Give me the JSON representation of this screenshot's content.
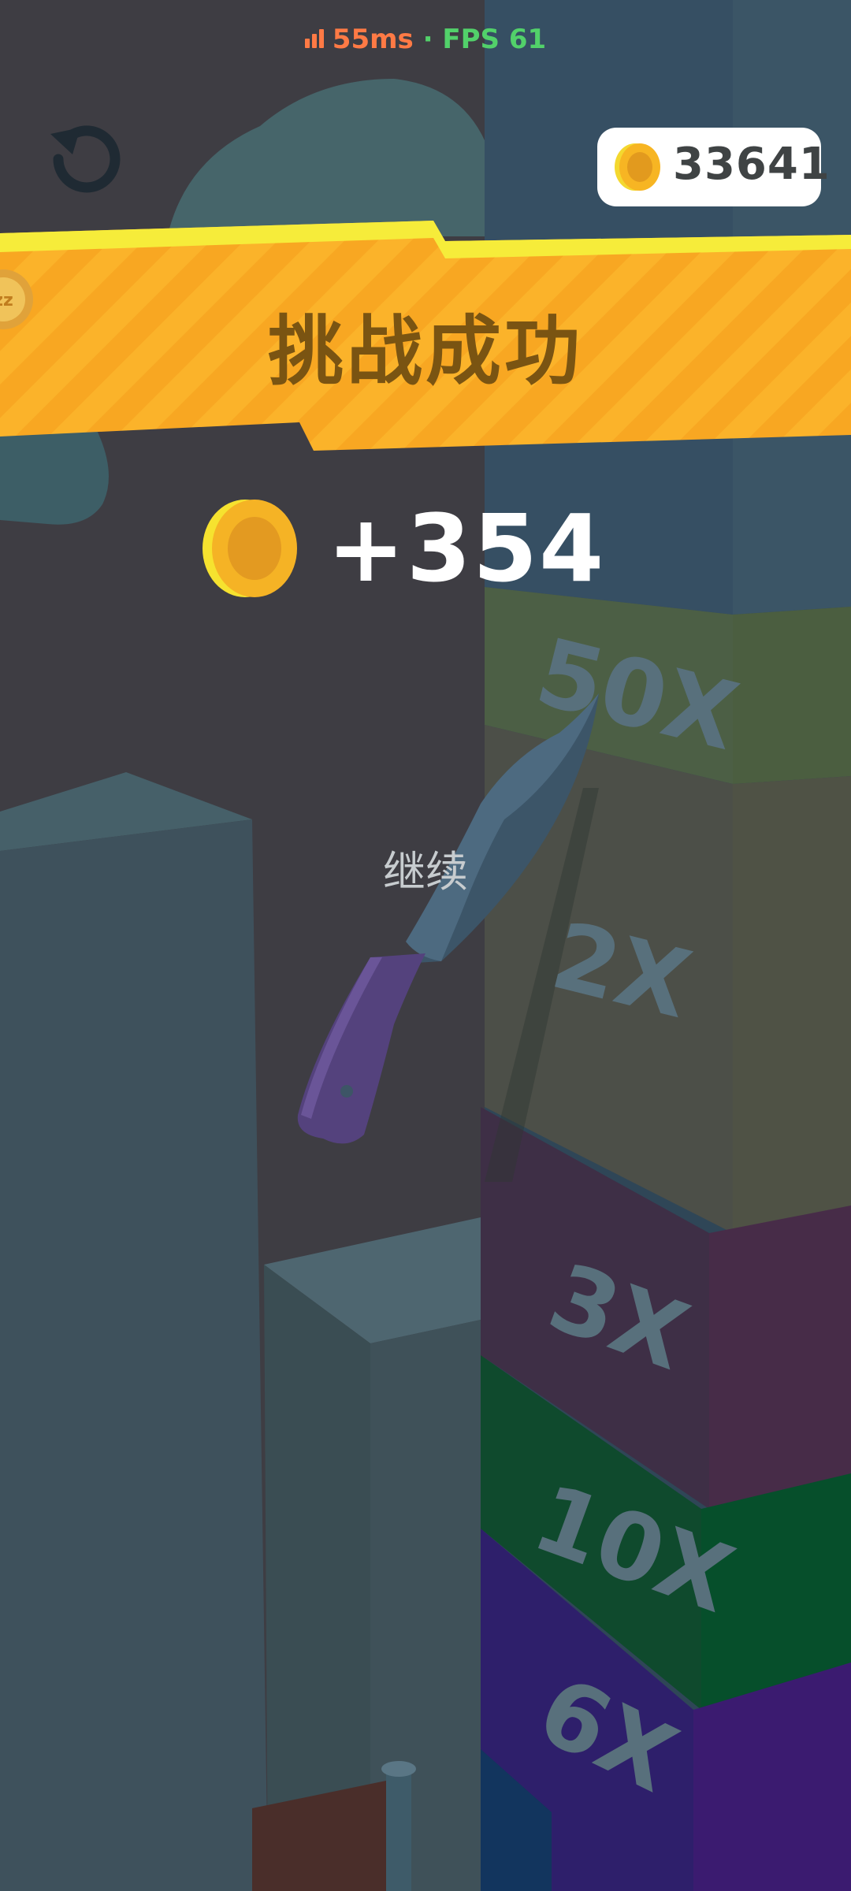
{
  "status": {
    "ping": "55ms",
    "separator": "·",
    "fps": "FPS 61"
  },
  "coins": {
    "count": "33641"
  },
  "banner": {
    "title": "挑战成功"
  },
  "reward": {
    "amount": "+354"
  },
  "continue_label": "继续",
  "tower_multipliers": [
    "50X",
    "2X",
    "3X",
    "10X",
    "6X"
  ],
  "icons": {
    "restart": "restart-icon",
    "coin": "coin-icon",
    "sleep_badge": "sleep-badge-icon"
  },
  "colors": {
    "banner": "#f8a722",
    "banner_highlight": "#f6ec3a",
    "coin": "#f5b325",
    "ping": "#ff7a45",
    "fps": "#52d16a"
  }
}
